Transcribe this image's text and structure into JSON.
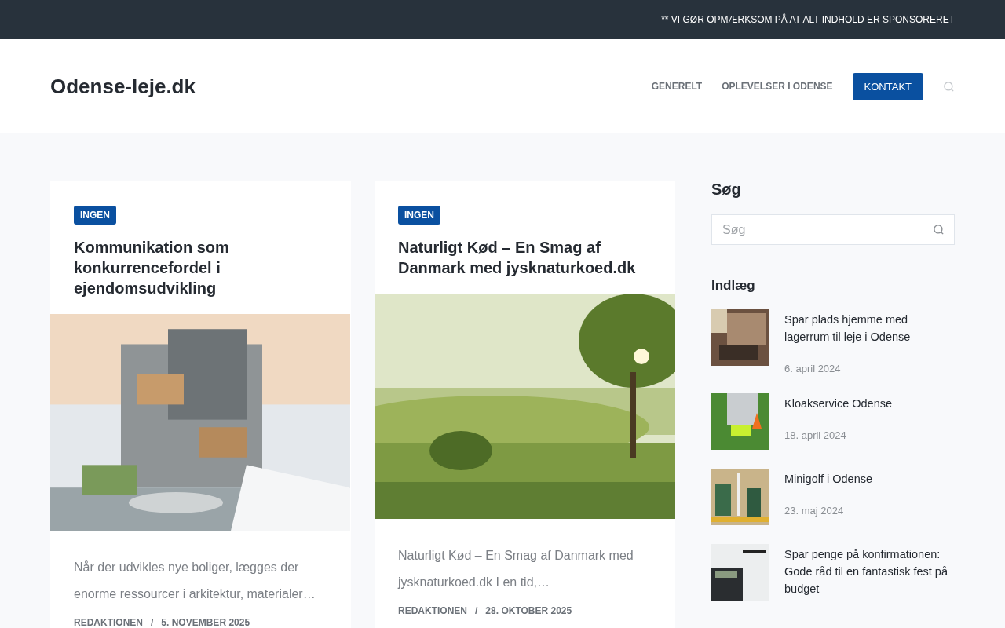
{
  "top_bar": {
    "notice": "** VI GØR OPMÆRKSOM PÅ AT ALT INDHOLD ER SPONSORERET"
  },
  "header": {
    "logo": "Odense-leje.dk",
    "nav": [
      {
        "label": "GENERELT",
        "kind": "link"
      },
      {
        "label": "OPLEVELSER I ODENSE",
        "kind": "link"
      },
      {
        "label": "KONTAKT",
        "kind": "button"
      }
    ]
  },
  "posts": [
    {
      "category": "INGEN",
      "title": "Kommunikation som konkurrencefordel i ejendomsudvikling",
      "excerpt": "Når der udvikles nye boliger, lægges der enorme ressourcer i arkitektur, materialer…",
      "author": "REDAKTIONEN",
      "separator": "/",
      "date": "5. NOVEMBER 2025"
    },
    {
      "category": "INGEN",
      "title": "Naturligt Kød – En Smag af Danmark med jysknaturkoed.dk",
      "excerpt": "Naturligt Kød – En Smag af Danmark med jysknaturkoed.dk I en tid,…",
      "author": "REDAKTIONEN",
      "separator": "/",
      "date": "28. OKTOBER 2025"
    }
  ],
  "sidebar": {
    "search_title": "Søg",
    "search": {
      "placeholder": "Søg"
    },
    "posts_title": "Indlæg",
    "recent": [
      {
        "title": "Spar plads hjemme med lagerrum til leje i Odense",
        "date": "6. april 2024"
      },
      {
        "title": "Kloakservice Odense",
        "date": "18. april 2024"
      },
      {
        "title": "Minigolf i Odense",
        "date": "23. maj 2024"
      },
      {
        "title": "Spar penge på konfirmationen: Gode råd til en fantastisk fest på budget"
      }
    ]
  }
}
